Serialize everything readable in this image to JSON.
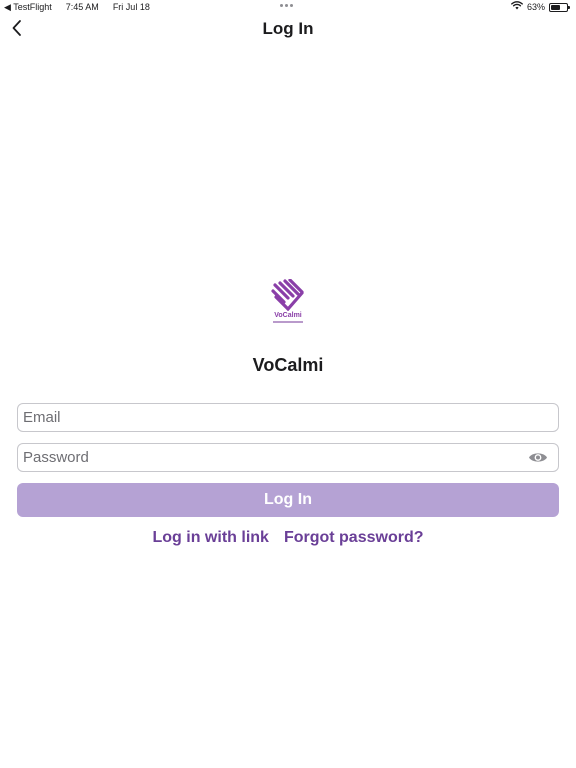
{
  "status_bar": {
    "back_app": "◀ TestFlight",
    "time": "7:45 AM",
    "date": "Fri Jul 18",
    "battery_text": "63%",
    "battery_level": 0.63
  },
  "nav": {
    "title": "Log In",
    "back_icon": "chevron-left-icon"
  },
  "logo": {
    "text": "VoCalmi",
    "icon": "vocalmi-heart-logo",
    "accent_color": "#8a3fa8"
  },
  "app_name": "VoCalmi",
  "form": {
    "email_placeholder": "Email",
    "email_value": "",
    "password_placeholder": "Password",
    "password_value": "",
    "password_toggle_icon": "eye-icon",
    "login_button": "Log In",
    "login_button_color": "#b5a2d4"
  },
  "links": {
    "login_with_link": "Log in with link",
    "forgot_password": "Forgot password?",
    "link_color": "#6a3f97"
  }
}
